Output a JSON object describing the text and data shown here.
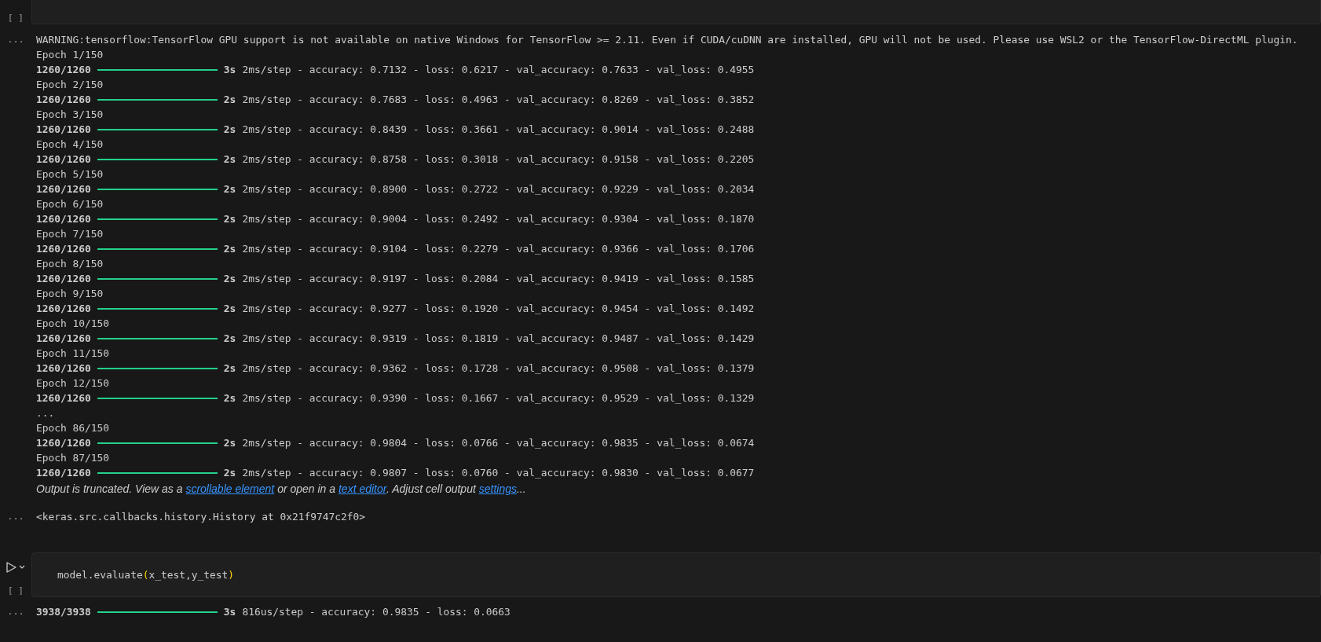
{
  "top_cell": {
    "run_status": "[ ]"
  },
  "training_output": {
    "more_icon": "...",
    "warning": "WARNING:tensorflow:TensorFlow GPU support is not available on native Windows for TensorFlow >= 2.11. Even if CUDA/cuDNN are installed, GPU will not be used. Please use WSL2 or the TensorFlow-DirectML plugin.",
    "lines": [
      {
        "kind": "epoch",
        "text": "Epoch 1/150"
      },
      {
        "kind": "progress",
        "steps": "1260/1260",
        "level": 1,
        "time": "3s",
        "rest": "2ms/step - accuracy: 0.7132 - loss: 0.6217 - val_accuracy: 0.7633 - val_loss: 0.4955"
      },
      {
        "kind": "epoch",
        "text": "Epoch 2/150"
      },
      {
        "kind": "progress",
        "steps": "1260/1260",
        "level": 1,
        "time": "2s",
        "rest": "2ms/step - accuracy: 0.7683 - loss: 0.4963 - val_accuracy: 0.8269 - val_loss: 0.3852"
      },
      {
        "kind": "epoch",
        "text": "Epoch 3/150"
      },
      {
        "kind": "progress",
        "steps": "1260/1260",
        "level": 1,
        "time": "2s",
        "rest": "2ms/step - accuracy: 0.8439 - loss: 0.3661 - val_accuracy: 0.9014 - val_loss: 0.2488"
      },
      {
        "kind": "epoch",
        "text": "Epoch 4/150"
      },
      {
        "kind": "progress",
        "steps": "1260/1260",
        "level": 1,
        "time": "2s",
        "rest": "2ms/step - accuracy: 0.8758 - loss: 0.3018 - val_accuracy: 0.9158 - val_loss: 0.2205"
      },
      {
        "kind": "epoch",
        "text": "Epoch 5/150"
      },
      {
        "kind": "progress",
        "steps": "1260/1260",
        "level": 1,
        "time": "2s",
        "rest": "2ms/step - accuracy: 0.8900 - loss: 0.2722 - val_accuracy: 0.9229 - val_loss: 0.2034"
      },
      {
        "kind": "epoch",
        "text": "Epoch 6/150"
      },
      {
        "kind": "progress",
        "steps": "1260/1260",
        "level": 1,
        "time": "2s",
        "rest": "2ms/step - accuracy: 0.9004 - loss: 0.2492 - val_accuracy: 0.9304 - val_loss: 0.1870"
      },
      {
        "kind": "epoch",
        "text": "Epoch 7/150"
      },
      {
        "kind": "progress",
        "steps": "1260/1260",
        "level": 1,
        "time": "2s",
        "rest": "2ms/step - accuracy: 0.9104 - loss: 0.2279 - val_accuracy: 0.9366 - val_loss: 0.1706"
      },
      {
        "kind": "epoch",
        "text": "Epoch 8/150"
      },
      {
        "kind": "progress",
        "steps": "1260/1260",
        "level": 1,
        "time": "2s",
        "rest": "2ms/step - accuracy: 0.9197 - loss: 0.2084 - val_accuracy: 0.9419 - val_loss: 0.1585"
      },
      {
        "kind": "epoch",
        "text": "Epoch 9/150"
      },
      {
        "kind": "progress",
        "steps": "1260/1260",
        "level": 1,
        "time": "2s",
        "rest": "2ms/step - accuracy: 0.9277 - loss: 0.1920 - val_accuracy: 0.9454 - val_loss: 0.1492"
      },
      {
        "kind": "epoch",
        "text": "Epoch 10/150"
      },
      {
        "kind": "progress",
        "steps": "1260/1260",
        "level": 1,
        "time": "2s",
        "rest": "2ms/step - accuracy: 0.9319 - loss: 0.1819 - val_accuracy: 0.9487 - val_loss: 0.1429"
      },
      {
        "kind": "epoch",
        "text": "Epoch 11/150"
      },
      {
        "kind": "progress",
        "steps": "1260/1260",
        "level": 1,
        "time": "2s",
        "rest": "2ms/step - accuracy: 0.9362 - loss: 0.1728 - val_accuracy: 0.9508 - val_loss: 0.1379"
      },
      {
        "kind": "epoch",
        "text": "Epoch 12/150"
      },
      {
        "kind": "progress",
        "steps": "1260/1260",
        "level": 1,
        "time": "2s",
        "rest": "2ms/step - accuracy: 0.9390 - loss: 0.1667 - val_accuracy: 0.9529 - val_loss: 0.1329"
      },
      {
        "kind": "epoch",
        "text": "..."
      },
      {
        "kind": "epoch",
        "text": "Epoch 86/150"
      },
      {
        "kind": "progress",
        "steps": "1260/1260",
        "level": 1,
        "time": "2s",
        "rest": "2ms/step - accuracy: 0.9804 - loss: 0.0766 - val_accuracy: 0.9835 - val_loss: 0.0674"
      },
      {
        "kind": "epoch",
        "text": "Epoch 87/150"
      },
      {
        "kind": "progress",
        "steps": "1260/1260",
        "level": 1,
        "time": "2s",
        "rest": "2ms/step - accuracy: 0.9807 - loss: 0.0760 - val_accuracy: 0.9830 - val_loss: 0.0677"
      }
    ],
    "truncated_notice": [
      {
        "kind": "text",
        "text": "Output is truncated. View as a "
      },
      {
        "kind": "link",
        "text": "scrollable element"
      },
      {
        "kind": "text",
        "text": " or open in a "
      },
      {
        "kind": "link",
        "text": "text editor"
      },
      {
        "kind": "text",
        "text": ". Adjust cell output "
      },
      {
        "kind": "link",
        "text": "settings"
      },
      {
        "kind": "text",
        "text": "..."
      }
    ]
  },
  "result_output": {
    "more_icon": "...",
    "text": "<keras.src.callbacks.history.History at 0x21f9747c2f0>"
  },
  "evaluate_cell": {
    "run_status": "[ ]",
    "code": [
      {
        "kind": "plain",
        "text": "model.evaluate"
      },
      {
        "kind": "bracket",
        "text": "("
      },
      {
        "kind": "plain",
        "text": "x_test,y_test"
      },
      {
        "kind": "bracket",
        "text": ")"
      }
    ]
  },
  "evaluate_output": {
    "more_icon": "...",
    "steps": "3938/3938",
    "level": 1,
    "time": "3s",
    "rest": "816us/step - accuracy: 0.9835 - loss: 0.0663"
  }
}
